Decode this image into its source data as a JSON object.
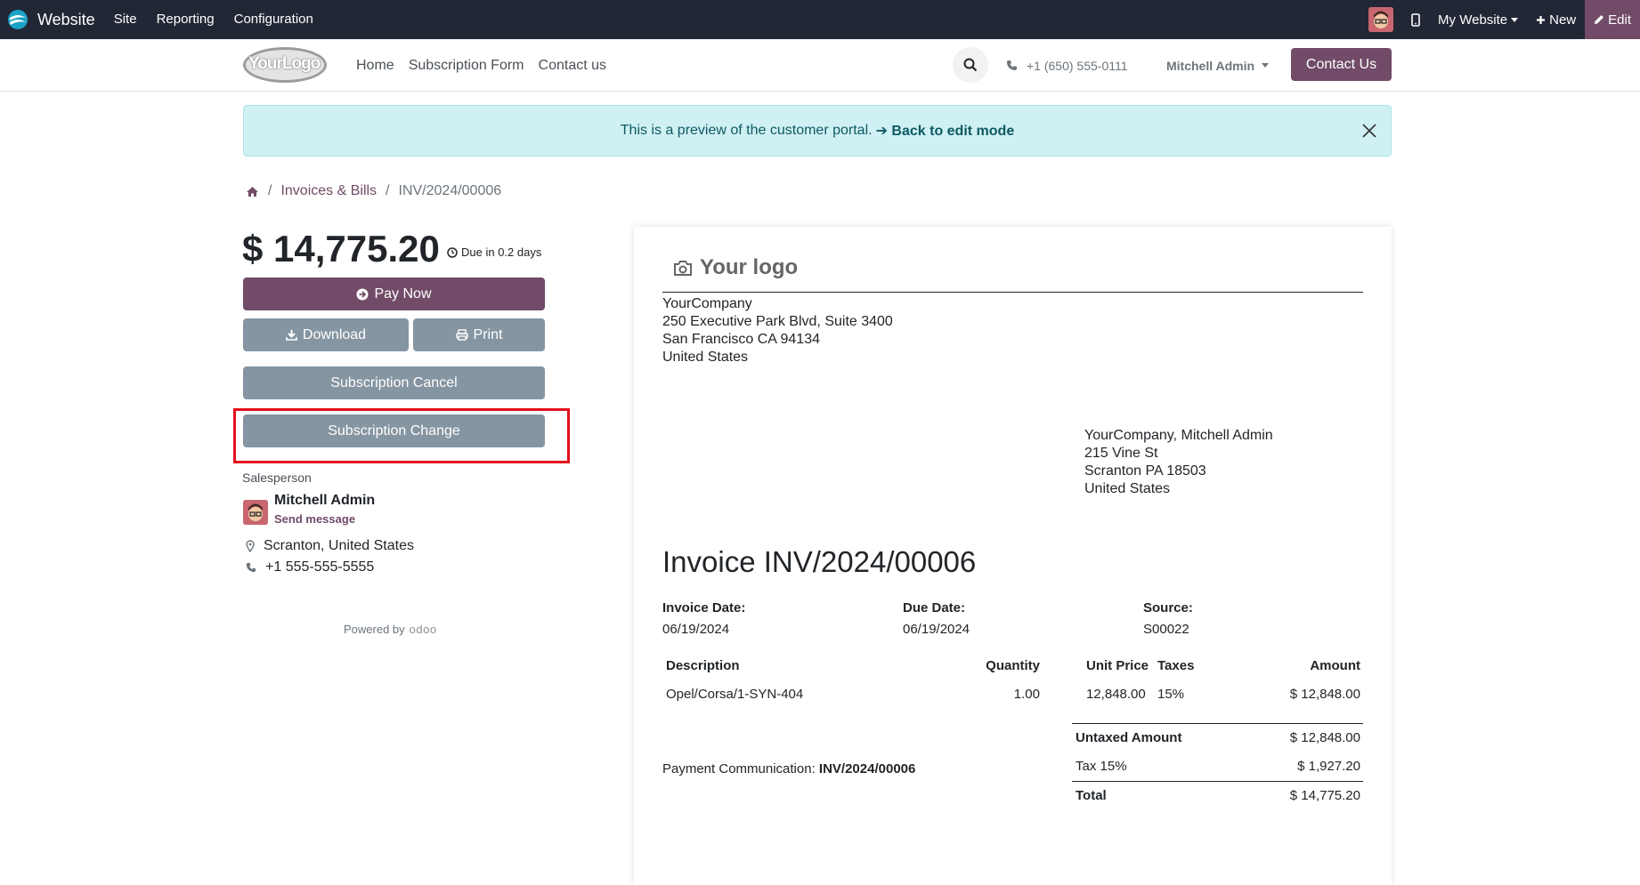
{
  "adminbar": {
    "app_name": "Website",
    "menu": [
      "Site",
      "Reporting",
      "Configuration"
    ],
    "website_switcher": "My Website",
    "new_label": "New",
    "edit_label": "Edit"
  },
  "header": {
    "logo_text": "YourLogo",
    "nav": [
      "Home",
      "Subscription Form",
      "Contact us"
    ],
    "phone": "+1 (650) 555-0111",
    "user": "Mitchell Admin",
    "contact_button": "Contact Us"
  },
  "alert": {
    "text": "This is a preview of the customer portal.",
    "link": "➔ Back to edit mode"
  },
  "breadcrumb": {
    "items": [
      "Invoices & Bills",
      "INV/2024/00006"
    ]
  },
  "sidebar": {
    "amount": "$ 14,775.20",
    "due": "Due in 0.2 days",
    "pay_now": "Pay Now",
    "download": "Download",
    "print": "Print",
    "subscription_cancel": "Subscription Cancel",
    "subscription_change": "Subscription Change",
    "salesperson_label": "Salesperson",
    "salesperson_name": "Mitchell Admin",
    "send_message": "Send message",
    "location": "Scranton, United States",
    "phone": "+1 555-555-5555",
    "powered_by": "Powered by",
    "powered_brand": "odoo"
  },
  "invoice": {
    "logo_text": "Your logo",
    "company_address": [
      "YourCompany",
      "250 Executive Park Blvd, Suite 3400",
      "San Francisco CA 94134",
      "United States"
    ],
    "customer_address": [
      "YourCompany, Mitchell Admin",
      "215 Vine St",
      "Scranton PA 18503",
      "United States"
    ],
    "title": "Invoice INV/2024/00006",
    "invoice_date_label": "Invoice Date:",
    "invoice_date": "06/19/2024",
    "due_date_label": "Due Date:",
    "due_date": "06/19/2024",
    "source_label": "Source:",
    "source": "S00022",
    "columns": {
      "description": "Description",
      "quantity": "Quantity",
      "unit_price": "Unit Price",
      "taxes": "Taxes",
      "amount": "Amount"
    },
    "lines": [
      {
        "description": "Opel/Corsa/1-SYN-404",
        "quantity": "1.00",
        "unit_price": "12,848.00",
        "taxes": "15%",
        "amount": "$ 12,848.00"
      }
    ],
    "untaxed_label": "Untaxed Amount",
    "untaxed": "$ 12,848.00",
    "tax_label": "Tax 15%",
    "tax": "$ 1,927.20",
    "total_label": "Total",
    "total": "$ 14,775.20",
    "payment_comm_label": "Payment Communication:",
    "payment_comm": "INV/2024/00006"
  },
  "colors": {
    "brand": "#714b67",
    "adminbar": "#212735",
    "grey_button": "#8595a2",
    "alert_bg": "#cff1f4",
    "highlight": "#e3101d"
  }
}
